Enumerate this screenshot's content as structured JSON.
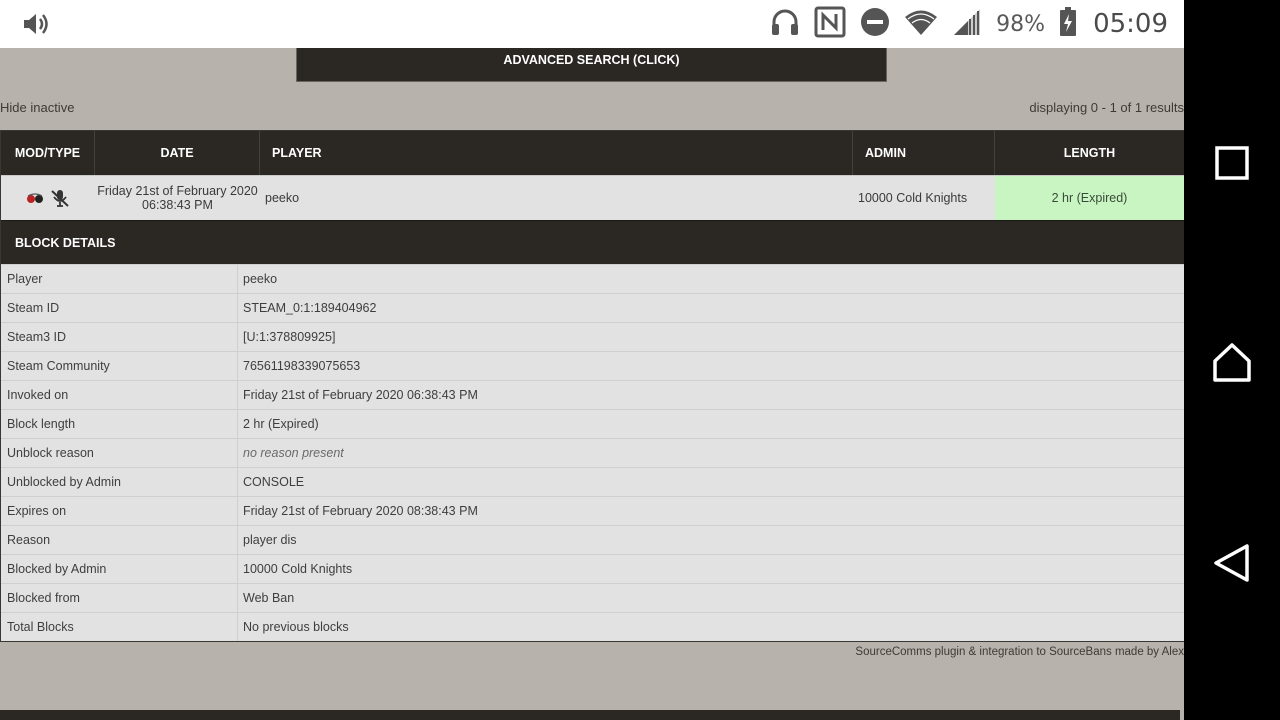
{
  "statusbar": {
    "battery_percent": "98%",
    "time": "05:09"
  },
  "page": {
    "advanced_search": "ADVANCED SEARCH (CLICK)",
    "hide_inactive": "Hide inactive",
    "displaying": "displaying 0 - 1 of 1 results"
  },
  "table": {
    "headers": [
      "MOD/TYPE",
      "DATE",
      "PLAYER",
      "ADMIN",
      "LENGTH"
    ],
    "row": {
      "date_line1": "Friday 21st of February 2020",
      "date_line2": "06:38:43 PM",
      "player": "peeko",
      "admin": "10000 Cold Knights",
      "length": "2 hr (Expired)"
    }
  },
  "details": {
    "title": "BLOCK DETAILS",
    "rows": [
      {
        "label": "Player",
        "value": "peeko"
      },
      {
        "label": "Steam ID",
        "value": "STEAM_0:1:189404962"
      },
      {
        "label": "Steam3 ID",
        "value": "[U:1:378809925]"
      },
      {
        "label": "Steam Community",
        "value": "76561198339075653"
      },
      {
        "label": "Invoked on",
        "value": "Friday 21st of February 2020 06:38:43 PM"
      },
      {
        "label": "Block length",
        "value": "2 hr (Expired)"
      },
      {
        "label": "Unblock reason",
        "value": "no reason present"
      },
      {
        "label": "Unblocked by Admin",
        "value": "CONSOLE"
      },
      {
        "label": "Expires on",
        "value": "Friday 21st of February 2020 08:38:43 PM"
      },
      {
        "label": "Reason",
        "value": "player dis"
      },
      {
        "label": "Blocked by Admin",
        "value": "10000 Cold Knights"
      },
      {
        "label": "Blocked from",
        "value": "Web Ban"
      },
      {
        "label": "Total Blocks",
        "value": "No previous blocks"
      }
    ]
  },
  "footer": {
    "credit": "SourceComms plugin & integration to SourceBans made by Alex"
  },
  "icons": {
    "mod": "game-mod-icon",
    "type": "mic-muted-icon"
  },
  "colors": {
    "header_bg": "#2b2723",
    "page_bg": "#b8b2ad",
    "row_bg": "#e2e2e2",
    "expired_bg": "#c9f5c2"
  }
}
